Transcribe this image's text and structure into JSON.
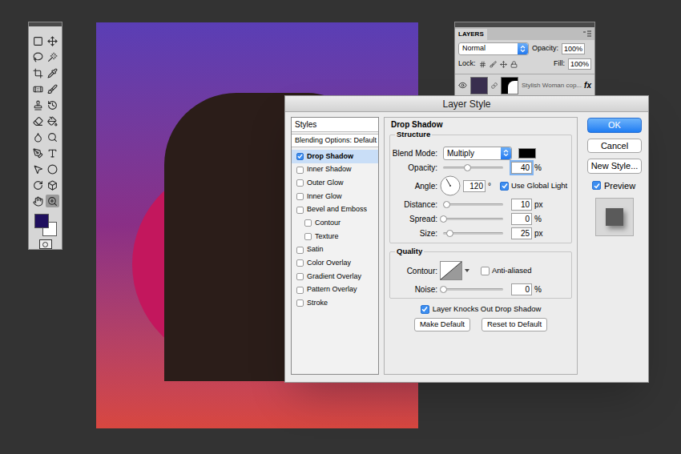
{
  "tools": [
    {
      "selected": false
    },
    {
      "selected": false
    },
    {
      "selected": false
    },
    {
      "selected": false
    },
    {
      "selected": false
    },
    {
      "selected": false
    },
    {
      "selected": false
    },
    {
      "selected": false
    },
    {
      "selected": false
    },
    {
      "selected": false
    },
    {
      "selected": false
    },
    {
      "selected": false
    },
    {
      "selected": false
    },
    {
      "selected": false
    },
    {
      "selected": false
    },
    {
      "selected": false
    },
    {
      "selected": false
    },
    {
      "selected": false
    },
    {
      "selected": false
    },
    {
      "selected": false
    },
    {
      "selected": false
    },
    {
      "selected": true
    }
  ],
  "swatches": [
    {
      "color": "#1f0f5e"
    },
    {
      "color": "#ffffff"
    }
  ],
  "layers_panel": {
    "tab": "LAYERS",
    "blend_mode": "Normal",
    "opacity_label": "Opacity:",
    "opacity": "100%",
    "lock_label": "Lock:",
    "fill_label": "Fill:",
    "fill": "100%",
    "layers": [
      {
        "name": "Stylish Woman cop...",
        "fx": "fx",
        "visible": true
      }
    ]
  },
  "dialog": {
    "title": "Layer Style",
    "styles_header": "Styles",
    "blending_options": "Blending Options: Default",
    "effects": [
      {
        "label": "Drop Shadow",
        "checked": true,
        "selected": true
      },
      {
        "label": "Inner Shadow",
        "checked": false,
        "selected": false
      },
      {
        "label": "Outer Glow",
        "checked": false,
        "selected": false
      },
      {
        "label": "Inner Glow",
        "checked": false,
        "selected": false
      },
      {
        "label": "Bevel and Emboss",
        "checked": false,
        "selected": false,
        "children": [
          {
            "label": "Contour",
            "checked": false,
            "selected": false
          },
          {
            "label": "Texture",
            "checked": false,
            "selected": false
          }
        ]
      },
      {
        "label": "Satin",
        "checked": false,
        "selected": false
      },
      {
        "label": "Color Overlay",
        "checked": false,
        "selected": false
      },
      {
        "label": "Gradient Overlay",
        "checked": false,
        "selected": false
      },
      {
        "label": "Pattern Overlay",
        "checked": false,
        "selected": false
      },
      {
        "label": "Stroke",
        "checked": false,
        "selected": false
      }
    ],
    "heading": "Drop Shadow",
    "structure": {
      "legend": "Structure",
      "blend_mode": {
        "label": "Blend Mode:",
        "value": "Multiply",
        "color": "#000000"
      },
      "rows": [
        {
          "kind": "slider",
          "label": "Opacity:",
          "value": "40",
          "unit": "%",
          "level": 0.4,
          "focused": true
        },
        {
          "kind": "angle",
          "label": "Angle:",
          "value": "120",
          "unit": "°",
          "check_label": "Use Global Light",
          "checked": true
        },
        {
          "kind": "slider",
          "label": "Distance:",
          "value": "10",
          "unit": "px",
          "level": 0.05,
          "focused": false
        },
        {
          "kind": "slider",
          "label": "Spread:",
          "value": "0",
          "unit": "%",
          "level": 0,
          "focused": false
        },
        {
          "kind": "slider",
          "label": "Size:",
          "value": "25",
          "unit": "px",
          "level": 0.1,
          "focused": false
        }
      ]
    },
    "quality": {
      "legend": "Quality",
      "contour": {
        "label": "Contour:",
        "check_label": "Anti-aliased",
        "checked": false
      },
      "noise": {
        "label": "Noise:",
        "value": "0",
        "unit": "%",
        "level": 0,
        "focused": false
      }
    },
    "knockout": {
      "label": "Layer Knocks Out Drop Shadow",
      "checked": true
    },
    "panel_buttons": [
      "Make Default",
      "Reset to Default"
    ],
    "actions": [
      {
        "label": "OK",
        "primary": true
      },
      {
        "label": "Cancel",
        "primary": false
      },
      {
        "label": "New Style...",
        "primary": false
      }
    ],
    "preview": {
      "label": "Preview",
      "checked": true
    }
  }
}
